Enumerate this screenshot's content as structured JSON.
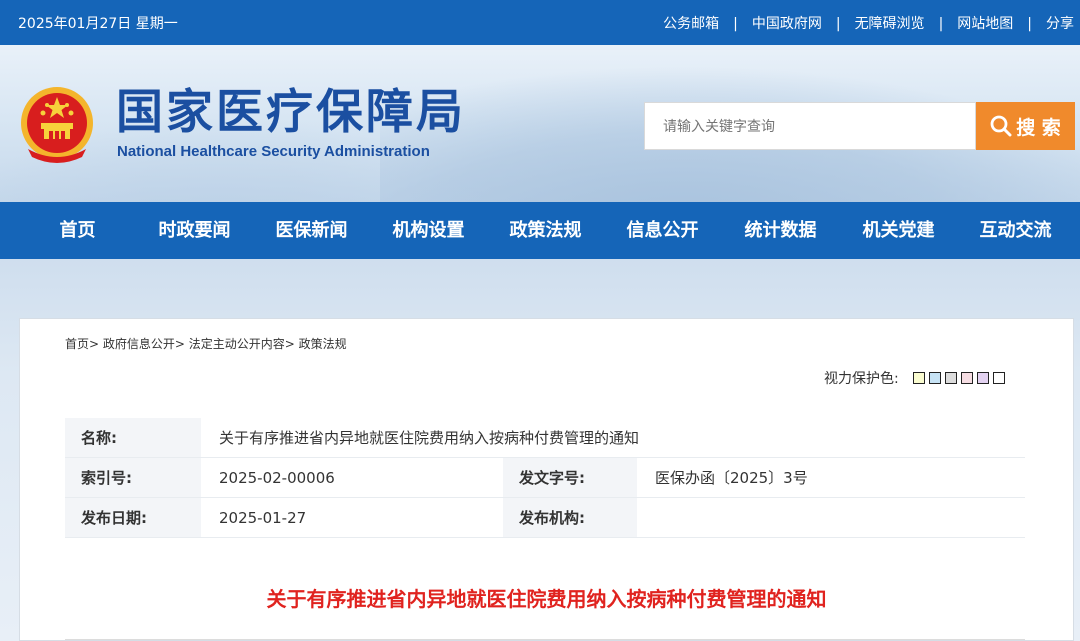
{
  "topbar": {
    "date": "2025年01月27日 星期一",
    "links": [
      "公务邮箱",
      "中国政府网",
      "无障碍浏览",
      "网站地图",
      "分享"
    ]
  },
  "header": {
    "logo_cn": "国家医疗保障局",
    "logo_en": "National Healthcare Security Administration",
    "search_placeholder": "请输入关键字查询",
    "search_button": "搜 索"
  },
  "nav": {
    "items": [
      "首页",
      "时政要闻",
      "医保新闻",
      "机构设置",
      "政策法规",
      "信息公开",
      "统计数据",
      "机关党建",
      "互动交流"
    ]
  },
  "breadcrumb": "首页> 政府信息公开> 法定主动公开内容> 政策法规",
  "vision": {
    "label": "视力保护色:",
    "colors": [
      "#fafcd0",
      "#c7e3f5",
      "#dcdcdc",
      "#f6dde3",
      "#e3d2f1",
      "#ffffff"
    ]
  },
  "info": {
    "name_label": "名称:",
    "name_value": "关于有序推进省内异地就医住院费用纳入按病种付费管理的通知",
    "index_label": "索引号:",
    "index_value": "2025-02-00006",
    "docno_label": "发文字号:",
    "docno_value": "医保办函〔2025〕3号",
    "date_label": "发布日期:",
    "date_value": "2025-01-27",
    "org_label": "发布机构:",
    "org_value": ""
  },
  "doc_title": "关于有序推进省内异地就医住院费用纳入按病种付费管理的通知",
  "colors": {
    "brand_blue": "#1565b8",
    "search_orange": "#f08a2c",
    "title_red": "#e0231f"
  }
}
